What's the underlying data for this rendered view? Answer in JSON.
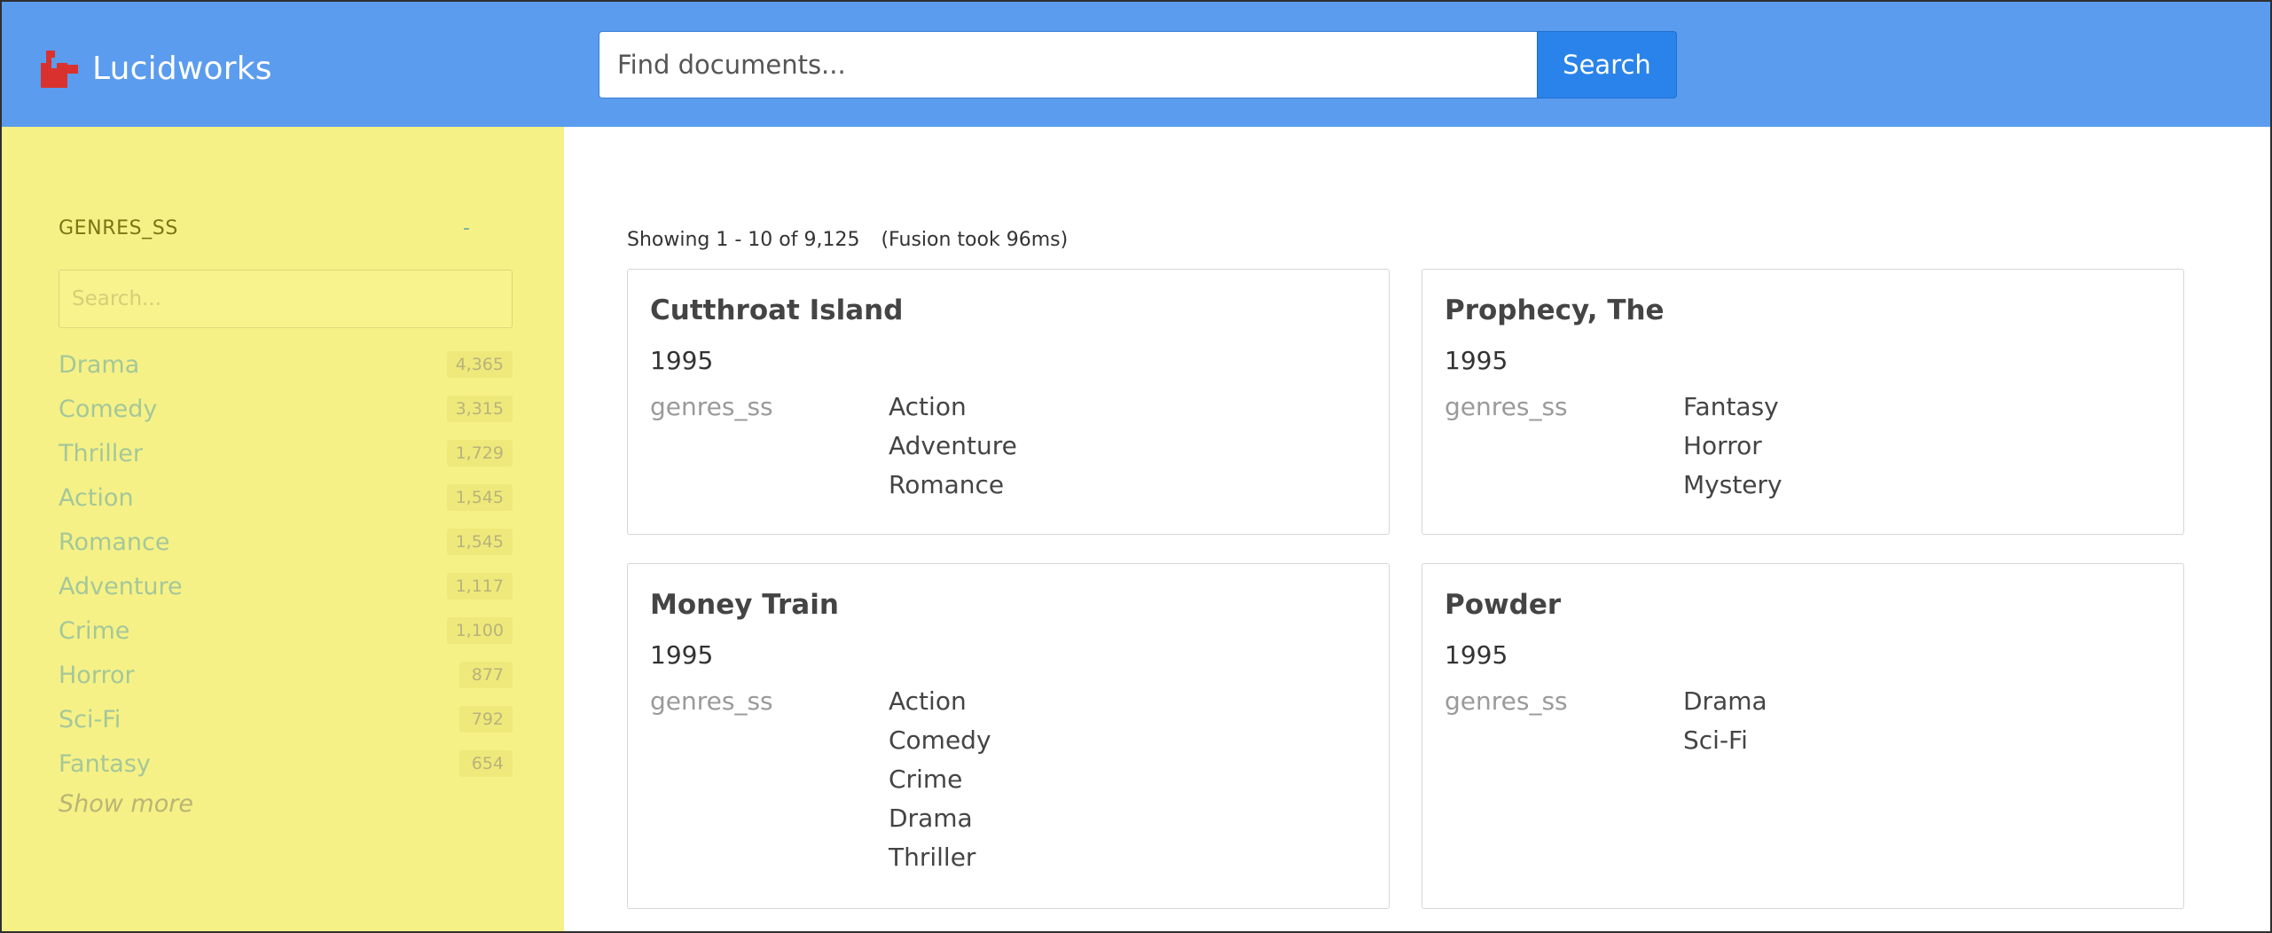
{
  "header": {
    "logo_text": "Lucidworks",
    "search": {
      "placeholder": "Find documents...",
      "value": "",
      "button_label": "Search"
    }
  },
  "colors": {
    "header_bg": "#5b9cee",
    "search_button": "#2a83ea",
    "sidebar_bg": "#f6f186",
    "logo_mark": "#d9322e"
  },
  "sidebar": {
    "facet_title": "GENRES_SS",
    "collapse_label": "-",
    "search_placeholder": "Search...",
    "items": [
      {
        "label": "Drama",
        "count": "4,365"
      },
      {
        "label": "Comedy",
        "count": "3,315"
      },
      {
        "label": "Thriller",
        "count": "1,729"
      },
      {
        "label": "Action",
        "count": "1,545"
      },
      {
        "label": "Romance",
        "count": "1,545"
      },
      {
        "label": "Adventure",
        "count": "1,117"
      },
      {
        "label": "Crime",
        "count": "1,100"
      },
      {
        "label": "Horror",
        "count": "877"
      },
      {
        "label": "Sci-Fi",
        "count": "792"
      },
      {
        "label": "Fantasy",
        "count": "654"
      }
    ],
    "show_more_label": "Show more"
  },
  "results": {
    "showing": "Showing 1 - 10 of 9,125",
    "took": "(Fusion took 96ms)",
    "cards": [
      {
        "title": "Cutthroat Island",
        "year": "1995",
        "field_label": "genres_ss",
        "values": [
          "Action",
          "Adventure",
          "Romance"
        ]
      },
      {
        "title": "Prophecy, The",
        "year": "1995",
        "field_label": "genres_ss",
        "values": [
          "Fantasy",
          "Horror",
          "Mystery"
        ]
      },
      {
        "title": "Money Train",
        "year": "1995",
        "field_label": "genres_ss",
        "values": [
          "Action",
          "Comedy",
          "Crime",
          "Drama",
          "Thriller"
        ]
      },
      {
        "title": "Powder",
        "year": "1995",
        "field_label": "genres_ss",
        "values": [
          "Drama",
          "Sci-Fi"
        ]
      }
    ]
  }
}
